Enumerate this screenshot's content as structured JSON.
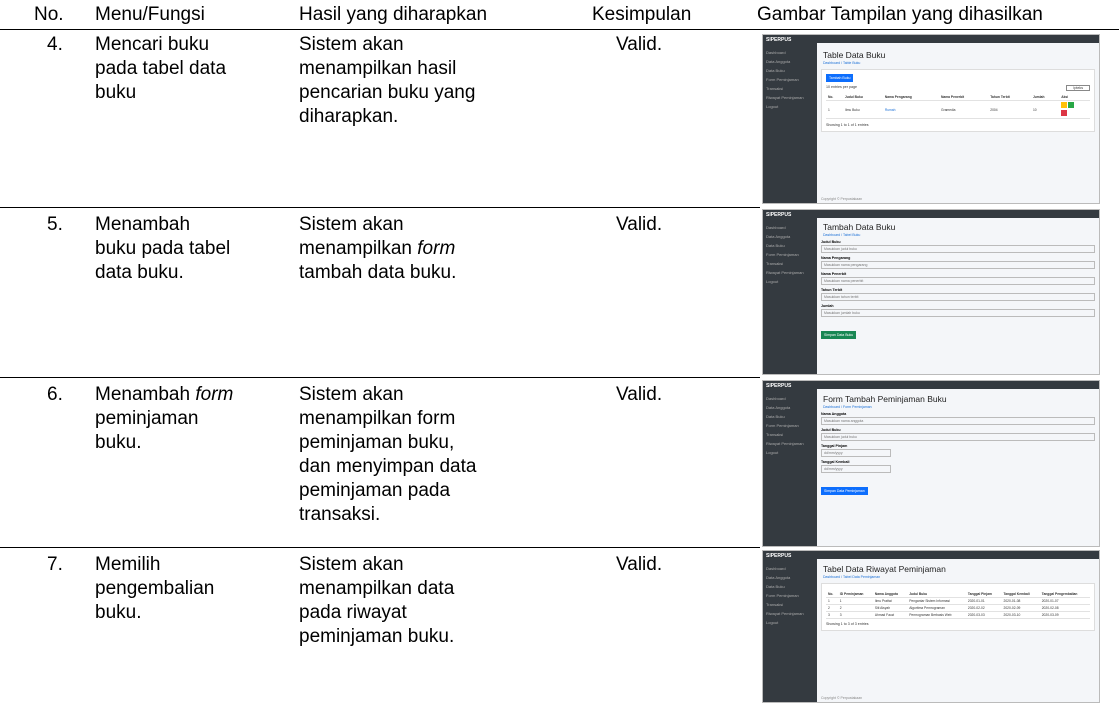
{
  "header": {
    "no": "No.",
    "menu": "Menu/Fungsi",
    "expected": "Hasil yang diharapkan",
    "conclusion": "Kesimpulan",
    "image": "Gambar Tampilan yang dihasilkan"
  },
  "rows": [
    {
      "no": "4.",
      "menu_lines": [
        "Mencari buku",
        "pada tabel data",
        "buku"
      ],
      "expected_lines": [
        "Sistem akan",
        "menampilkan hasil",
        "pencarian buku yang",
        "diharapkan."
      ],
      "conclusion": "Valid."
    },
    {
      "no": "5.",
      "menu_lines": [
        "Menambah",
        "buku pada tabel",
        "data buku."
      ],
      "expected_lines": [
        "Sistem akan",
        "menampilkan form",
        "tambah data buku."
      ],
      "conclusion": "Valid."
    },
    {
      "no": "6.",
      "menu_lines": [
        "Menambah form",
        "peminjaman",
        "buku."
      ],
      "expected_lines": [
        "Sistem akan",
        "menampilkan form",
        "peminjaman buku,",
        "dan menyimpan data",
        "peminjaman pada",
        "transaksi."
      ],
      "conclusion": "Valid."
    },
    {
      "no": "7.",
      "menu_lines": [
        "Memilih",
        "pengembalian",
        "buku."
      ],
      "expected_lines": [
        "Sistem akan",
        "menampilkan data",
        "pada riwayat",
        "peminjaman buku."
      ],
      "conclusion": "Valid."
    }
  ],
  "shots": {
    "brand": "SIPERPUS",
    "nav": [
      "Dashboard",
      "Data Anggota",
      "Data Buku",
      "Form Peminjaman",
      "Transaksi",
      "Riwayat Peminjaman",
      "Logout"
    ],
    "s4": {
      "title": "Table Data Buku",
      "crumb": "Dashboard / Table Buku",
      "add_btn": "Tambah Buku",
      "show": "10 entries per page",
      "search": "Ipteks",
      "cols": [
        "No.",
        "Judul Buku",
        "Nama Pengarang",
        "Nama Penerbit",
        "Tahun Terbit",
        "Jumlah",
        "Aksi"
      ],
      "row": [
        "1",
        "Ilmu Buku",
        "Rumah",
        "Gramedia",
        "2004",
        "10"
      ],
      "info": "Showing 1 to 1 of 1 entries",
      "footer": "Copyright © Perpustakaan"
    },
    "s5": {
      "title": "Tambah Data Buku",
      "crumb": "Dashboard / Tabel Buku",
      "fields": [
        {
          "label": "Judul Buku",
          "ph": "Masukkan judul buku"
        },
        {
          "label": "Nama Pengarang",
          "ph": "Masukkan nama pengarang"
        },
        {
          "label": "Nama Penerbit",
          "ph": "Masukkan nama penerbit"
        },
        {
          "label": "Tahun Terbit",
          "ph": "Masukkan tahun terbit"
        },
        {
          "label": "Jumlah",
          "ph": "Masukkan jumlah buku"
        }
      ],
      "btn": "Simpan Data Buku"
    },
    "s6": {
      "title": "Form Tambah Peminjaman Buku",
      "crumb": "Dashboard / Form Peminjaman",
      "fields": [
        {
          "label": "Nama Anggota",
          "ph": "Masukkan nama anggota"
        },
        {
          "label": "Judul Buku",
          "ph": "Masukkan judul buku"
        },
        {
          "label": "Tanggal Pinjam",
          "ph": "dd/mm/yyyy"
        },
        {
          "label": "Tanggal Kembali",
          "ph": "dd/mm/yyyy"
        }
      ],
      "btn": "Simpan Data Peminjaman"
    },
    "s7": {
      "title": "Tabel Data Riwayat Peminjaman",
      "crumb": "Dashboard / Tabel Data Peminjaman",
      "cols": [
        "No.",
        "ID Peminjaman",
        "Nama Anggota",
        "Judul Buku",
        "Tanggal Pinjam",
        "Tanggal Kembali",
        "Tanggal Pengembalian"
      ],
      "rows": [
        [
          "1",
          "1",
          "Ilmu Pratiwi",
          "Pengantar Sistem Informasi",
          "2020-01-01",
          "2020-01-08",
          "2020-01-07"
        ],
        [
          "2",
          "2",
          "Siti Aisyah",
          "Algoritma Pemrograman",
          "2020-02-02",
          "2020-02-09",
          "2020-02-08"
        ],
        [
          "3",
          "3",
          "Ahmad Fauzi",
          "Pemrograman Berbasis Web",
          "2020-03-03",
          "2020-03-10",
          "2020-03-09"
        ]
      ],
      "info": "Showing 1 to 3 of 3 entries",
      "footer": "Copyright © Perpustakaan"
    }
  }
}
